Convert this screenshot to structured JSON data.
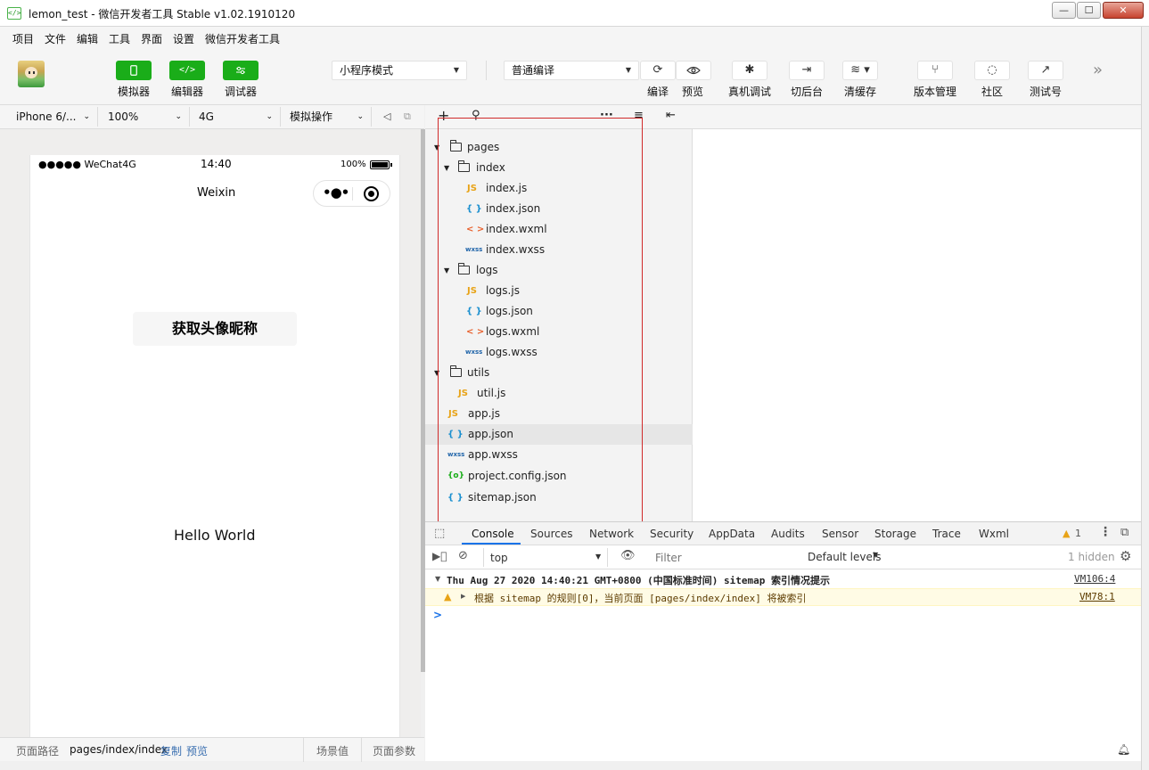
{
  "window": {
    "icon": "</>",
    "title": "lemon_test - 微信开发者工具 Stable v1.02.1910120",
    "min": "—",
    "max": "☐",
    "close": "✕"
  },
  "menu": [
    "项目",
    "文件",
    "编辑",
    "工具",
    "界面",
    "设置",
    "微信开发者工具"
  ],
  "toolbar": {
    "simulator_label": "模拟器",
    "editor_label": "编辑器",
    "debugger_label": "调试器",
    "mode_select": "小程序模式",
    "compile_select": "普通编译",
    "compile_label": "编译",
    "preview_label": "预览",
    "remote_debug_label": "真机调试",
    "background_label": "切后台",
    "clear_cache_label": "清缓存",
    "version_label": "版本管理",
    "community_label": "社区",
    "test_account_label": "测试号",
    "more": "»",
    "accent": "#1aad19"
  },
  "device_bar": {
    "device": "iPhone 6/...",
    "zoom": "100%",
    "network": "4G",
    "sim_ops": "模拟操作"
  },
  "phone": {
    "carrier": "●●●●● WeChat4G",
    "time": "14:40",
    "battery": "100%",
    "nav_title": "Weixin",
    "button": "获取头像昵称",
    "hello": "Hello World"
  },
  "sim_footer": {
    "path_label": "页面路径",
    "path": "pages/index/index",
    "copy": "复制",
    "preview": "预览",
    "scene": "场景值",
    "params": "页面参数"
  },
  "tree": [
    {
      "type": "folder",
      "label": "pages"
    },
    {
      "type": "folder",
      "label": "index"
    },
    {
      "type": "js",
      "label": "index.js"
    },
    {
      "type": "json",
      "label": "index.json"
    },
    {
      "type": "wxml",
      "label": "index.wxml"
    },
    {
      "type": "wxss",
      "label": "index.wxss"
    },
    {
      "type": "folder",
      "label": "logs"
    },
    {
      "type": "js",
      "label": "logs.js"
    },
    {
      "type": "json",
      "label": "logs.json"
    },
    {
      "type": "wxml",
      "label": "logs.wxml"
    },
    {
      "type": "wxss",
      "label": "logs.wxss"
    },
    {
      "type": "folder",
      "label": "utils"
    },
    {
      "type": "js",
      "label": "util.js"
    },
    {
      "type": "js",
      "label": "app.js"
    },
    {
      "type": "json",
      "label": "app.json"
    },
    {
      "type": "wxss",
      "label": "app.wxss"
    },
    {
      "type": "config",
      "label": "project.config.json"
    },
    {
      "type": "json",
      "label": "sitemap.json"
    }
  ],
  "tree_icons": {
    "js": "JS",
    "json": "{ }",
    "wxml": "< >",
    "wxss": "wxss",
    "config": "{o}"
  },
  "tree_toolbar": {
    "add": "+",
    "search": "⚲",
    "more": "···",
    "sort": "≡",
    "collapse": "⇤"
  },
  "console": {
    "tabs": [
      "Console",
      "Sources",
      "Network",
      "Security",
      "AppData",
      "Audits",
      "Sensor",
      "Storage",
      "Trace",
      "Wxml"
    ],
    "warn_count": "1",
    "context": "top",
    "filter_placeholder": "Filter",
    "levels": "Default levels",
    "hidden": "1 hidden",
    "group_title": "Thu Aug 27 2020 14:40:21 GMT+0800 (中国标准时间) sitemap 索引情况提示",
    "group_src": "VM106:4",
    "warn_text": "根据 sitemap 的规则[0]，当前页面 [pages/index/index] 将被索引",
    "warn_src": "VM78:1",
    "prompt": ">"
  }
}
